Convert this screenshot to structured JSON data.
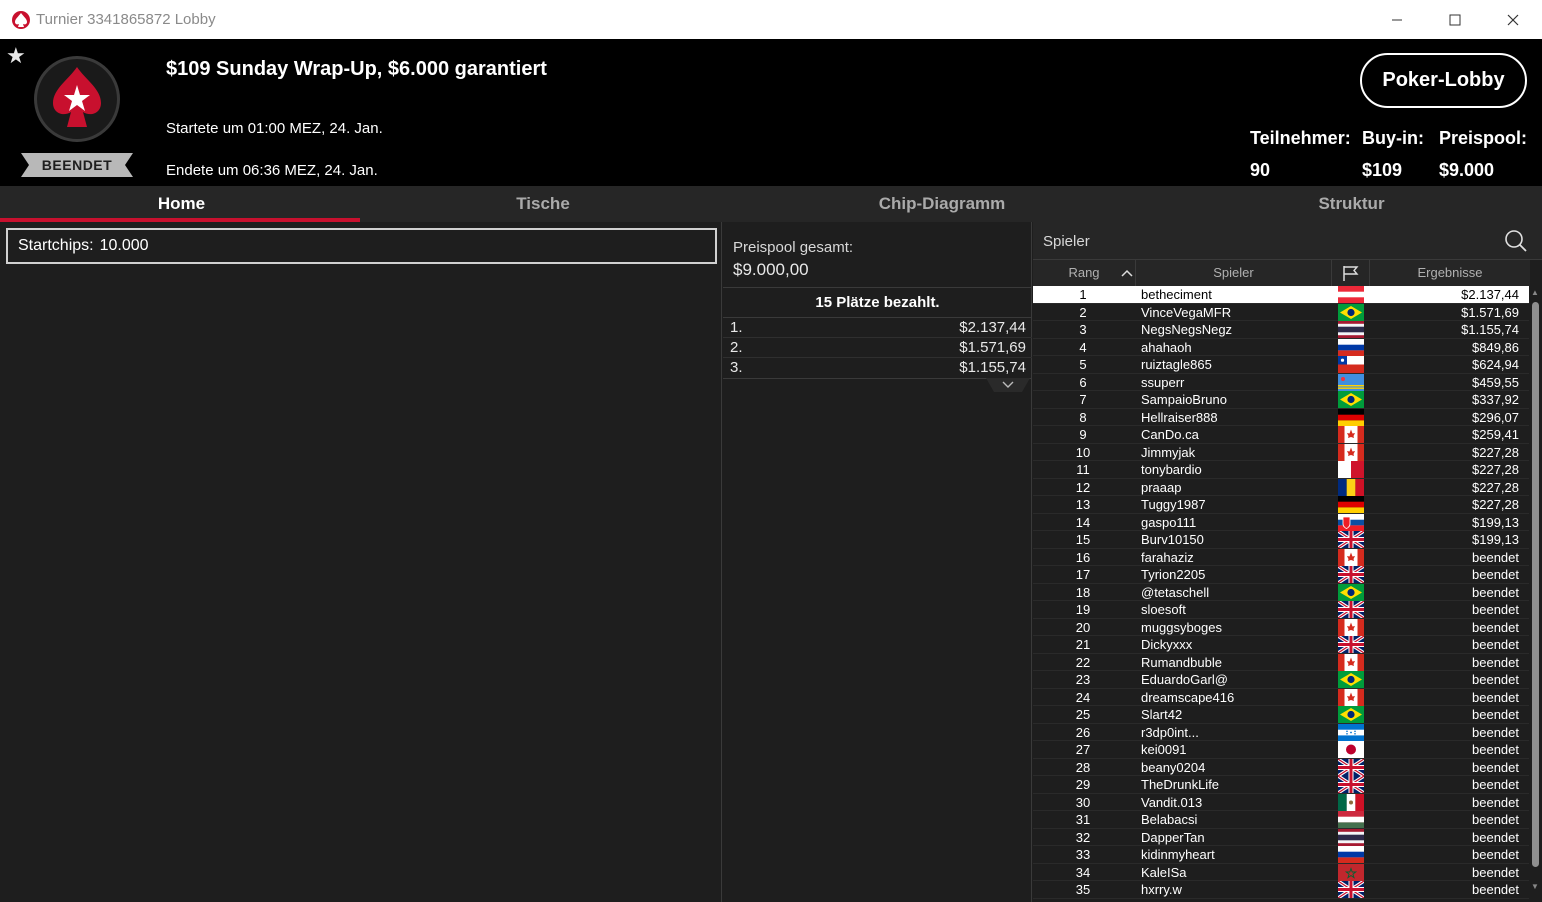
{
  "window": {
    "title": "Turnier 3341865872 Lobby",
    "controls": [
      "minimize",
      "maximize",
      "close"
    ]
  },
  "header": {
    "tournament_title": "$109 Sunday Wrap-Up, $6.000 garantiert",
    "started": "Startete um 01:00 MEZ, 24. Jan.",
    "ended": "Endete um 06:36 MEZ, 24. Jan.",
    "status": "BEENDET",
    "lobby_button": "Poker-Lobby",
    "stats": {
      "participants_label": "Teilnehmer:",
      "participants_value": "90",
      "buyin_label": "Buy-in:",
      "buyin_value": "$109",
      "prizepool_label": "Preispool:",
      "prizepool_value": "$9.000"
    },
    "colors": {
      "brand": "#c8102e",
      "bg": "#000000"
    }
  },
  "tabs": [
    {
      "label": "Home",
      "active": true
    },
    {
      "label": "Tische",
      "active": false
    },
    {
      "label": "Chip-Diagramm",
      "active": false
    },
    {
      "label": "Struktur",
      "active": false
    }
  ],
  "left": {
    "startchips_label": "Startchips:",
    "startchips_value": "10.000"
  },
  "middle": {
    "pool_label": "Preispool gesamt:",
    "pool_value": "$9.000,00",
    "paid_header": "15 Plätze bezahlt.",
    "payouts": [
      {
        "place": "1.",
        "amount": "$2.137,44"
      },
      {
        "place": "2.",
        "amount": "$1.571,69"
      },
      {
        "place": "3.",
        "amount": "$1.155,74"
      }
    ]
  },
  "right": {
    "search_placeholder": "Spieler",
    "columns": {
      "rank": "Rang",
      "player": "Spieler",
      "result": "Ergebnisse"
    },
    "players": [
      {
        "rank": "1",
        "name": "betheciment",
        "flag": "at",
        "result": "$2.137,44"
      },
      {
        "rank": "2",
        "name": "VinceVegaMFR",
        "flag": "br",
        "result": "$1.571,69"
      },
      {
        "rank": "3",
        "name": "NegsNegsNegz",
        "flag": "th",
        "result": "$1.155,74"
      },
      {
        "rank": "4",
        "name": "ahahaoh",
        "flag": "ru",
        "result": "$849,86"
      },
      {
        "rank": "5",
        "name": "ruiztagle865",
        "flag": "cl",
        "result": "$624,94"
      },
      {
        "rank": "6",
        "name": "ssuperr",
        "flag": "aw",
        "result": "$459,55"
      },
      {
        "rank": "7",
        "name": "SampaioBruno",
        "flag": "br",
        "result": "$337,92"
      },
      {
        "rank": "8",
        "name": "Hellraiser888",
        "flag": "de",
        "result": "$296,07"
      },
      {
        "rank": "9",
        "name": "CanDo.ca",
        "flag": "ca",
        "result": "$259,41"
      },
      {
        "rank": "10",
        "name": "Jimmyjak",
        "flag": "ca",
        "result": "$227,28"
      },
      {
        "rank": "11",
        "name": "tonybardio",
        "flag": "mt",
        "result": "$227,28"
      },
      {
        "rank": "12",
        "name": "praaap",
        "flag": "ro",
        "result": "$227,28"
      },
      {
        "rank": "13",
        "name": "Tuggy1987",
        "flag": "de",
        "result": "$227,28"
      },
      {
        "rank": "14",
        "name": "gaspo111",
        "flag": "sk",
        "result": "$199,13"
      },
      {
        "rank": "15",
        "name": "Burv10150",
        "flag": "gb",
        "result": "$199,13"
      },
      {
        "rank": "16",
        "name": "farahaziz",
        "flag": "ca",
        "result": "beendet"
      },
      {
        "rank": "17",
        "name": "Tyrion2205",
        "flag": "gb",
        "result": "beendet"
      },
      {
        "rank": "18",
        "name": "@tetaschell",
        "flag": "br",
        "result": "beendet"
      },
      {
        "rank": "19",
        "name": "sloesoft",
        "flag": "gb",
        "result": "beendet"
      },
      {
        "rank": "20",
        "name": "muggsyboges",
        "flag": "ca",
        "result": "beendet"
      },
      {
        "rank": "21",
        "name": "Dickyxxx",
        "flag": "gb",
        "result": "beendet"
      },
      {
        "rank": "22",
        "name": "Rumandbuble",
        "flag": "ca",
        "result": "beendet"
      },
      {
        "rank": "23",
        "name": "EduardoGarl@",
        "flag": "br",
        "result": "beendet"
      },
      {
        "rank": "24",
        "name": "dreamscape416",
        "flag": "ca",
        "result": "beendet"
      },
      {
        "rank": "25",
        "name": "Slart42",
        "flag": "br",
        "result": "beendet"
      },
      {
        "rank": "26",
        "name": "r3dp0int...",
        "flag": "hn",
        "result": "beendet"
      },
      {
        "rank": "27",
        "name": "kei0091",
        "flag": "jp",
        "result": "beendet"
      },
      {
        "rank": "28",
        "name": "beany0204",
        "flag": "gb",
        "result": "beendet"
      },
      {
        "rank": "29",
        "name": "TheDrunkLife",
        "flag": "gb",
        "result": "beendet"
      },
      {
        "rank": "30",
        "name": "Vandit.013",
        "flag": "mx",
        "result": "beendet"
      },
      {
        "rank": "31",
        "name": "Belabacsi",
        "flag": "hu",
        "result": "beendet"
      },
      {
        "rank": "32",
        "name": "DapperTan",
        "flag": "th",
        "result": "beendet"
      },
      {
        "rank": "33",
        "name": "kidinmyheart",
        "flag": "ru",
        "result": "beendet"
      },
      {
        "rank": "34",
        "name": "KaleISa",
        "flag": "ma",
        "result": "beendet"
      },
      {
        "rank": "35",
        "name": "hxrry.w",
        "flag": "gb",
        "result": "beendet"
      }
    ]
  }
}
